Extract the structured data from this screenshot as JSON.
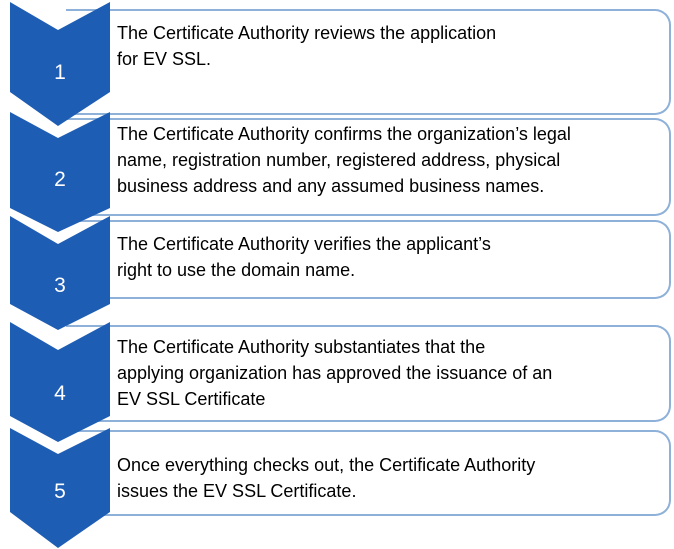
{
  "steps": [
    {
      "number": "1",
      "text": "The Certificate Authority reviews the application\nfor EV SSL."
    },
    {
      "number": "2",
      "text": "The Certificate Authority confirms the organization’s legal\nname, registration number, registered address, physical\nbusiness address and any assumed business names."
    },
    {
      "number": "3",
      "text": "The Certificate Authority verifies the applicant’s\nright to use the domain name."
    },
    {
      "number": "4",
      "text": "The Certificate Authority substantiates that the\napplying organization has approved the issuance of an\nEV SSL Certificate"
    },
    {
      "number": "5",
      "text": "Once everything checks out, the Certificate Authority\nissues the EV SSL Certificate."
    }
  ],
  "colors": {
    "chevron_fill": "#1e5db4",
    "box_border": "#8eb1d9",
    "number_text": "#ffffff",
    "body_text": "#000000"
  }
}
